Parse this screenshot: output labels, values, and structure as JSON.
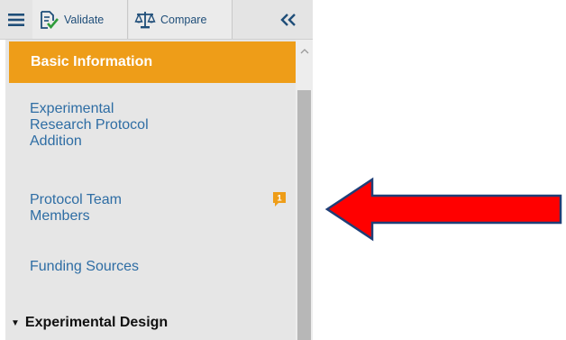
{
  "toolbar": {
    "menu_icon": "hamburger-icon",
    "validate_label": "Validate",
    "validate_icon": "document-check-icon",
    "compare_label": "Compare",
    "compare_icon": "balance-scale-icon",
    "collapse_icon": "double-chevron-left-icon"
  },
  "nav": {
    "active_item": "Basic Information",
    "items": [
      {
        "lines": [
          "Experimental",
          "Research Protocol",
          "Addition"
        ]
      },
      {
        "lines": [
          "Protocol Team",
          "Members"
        ],
        "badge": "1"
      },
      {
        "lines": [
          "Funding Sources"
        ]
      }
    ],
    "section_title": "Experimental Design"
  },
  "colors": {
    "active_bg": "#ee9d18",
    "link": "#2e6da4",
    "badge": "#ee9d18",
    "arrow": "#ff0000"
  }
}
